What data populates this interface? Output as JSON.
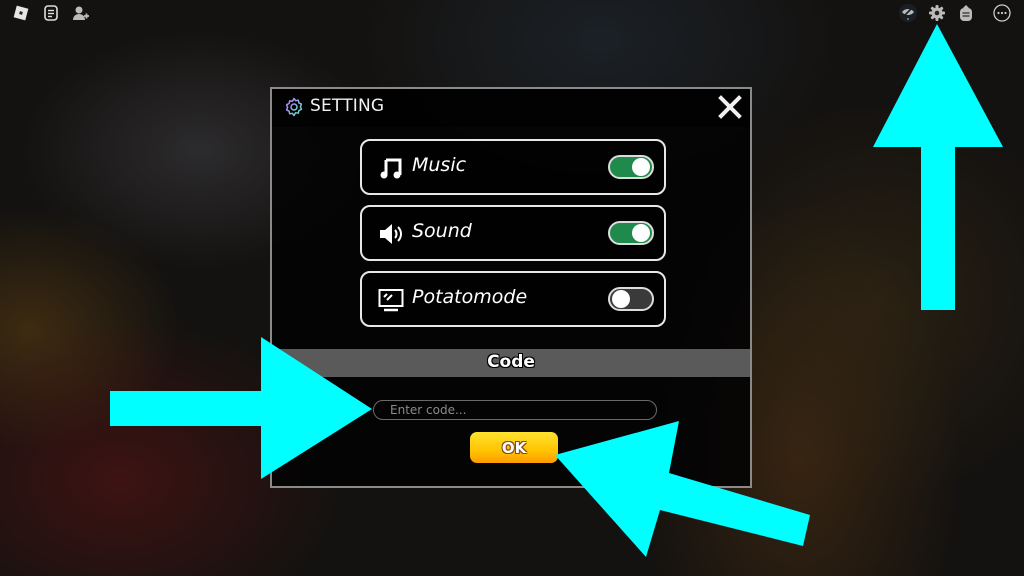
{
  "topbar": {
    "left_icons": [
      "roblox-menu-icon",
      "chat-icon",
      "add-friend-icon"
    ],
    "right_icons": [
      "hide-ui-icon",
      "settings-gear-icon",
      "backpack-icon",
      "more-icon"
    ]
  },
  "dialog": {
    "title": "SETTING",
    "title_icon": "gear-icon",
    "close_icon": "close-icon",
    "options": [
      {
        "label": "Music",
        "icon": "music-note-icon",
        "enabled": true
      },
      {
        "label": "Sound",
        "icon": "speaker-icon",
        "enabled": true
      },
      {
        "label": "Potatomode",
        "icon": "monitor-icon",
        "enabled": false
      }
    ],
    "code": {
      "section_title": "Code",
      "input_value": "",
      "input_placeholder": "Enter code...",
      "submit_label": "OK"
    }
  },
  "annotations": {
    "color": "#00ffff",
    "arrows": [
      "arrow-to-settings-gear",
      "arrow-to-code-input",
      "arrow-to-ok-button"
    ]
  },
  "colors": {
    "toggle_on": "#1f8a4c",
    "toggle_off": "#3a3a3a",
    "ok_button": "#ffc400"
  }
}
